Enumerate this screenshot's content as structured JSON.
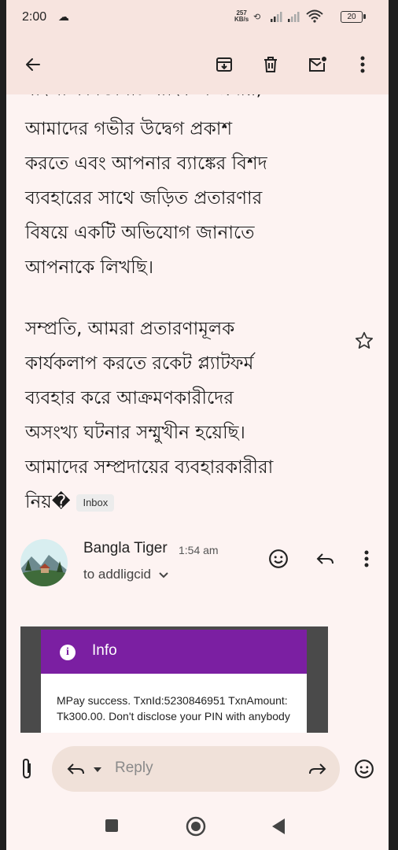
{
  "status_bar": {
    "time": "2:00",
    "net_rate_value": "257",
    "net_rate_unit": "KB/s",
    "battery": "20"
  },
  "toolbar": {
    "icons": [
      "back-arrow-icon",
      "archive-icon",
      "delete-icon",
      "mark-unread-icon",
      "more-vert-icon"
    ]
  },
  "email": {
    "clipped_line": "বাংলা কমিউনিটি ব্যাংক সম্প্রদায়,",
    "paragraph1": [
      "আমাদের গভীর উদ্বেগ প্রকাশ",
      "করতে এবং আপনার ব্যাঙ্কের বিশদ",
      "ব্যবহারের সাথে জড়িত প্রতারণার",
      "বিষয়ে একটি অভিযোগ জানাতে",
      "আপনাকে লিখছি।"
    ],
    "paragraph2": [
      "সম্প্রতি, আমরা প্রতারণামূলক",
      "কার্যকলাপ করতে রকেট প্ল্যাটফর্ম",
      "ব্যবহার করে আক্রমণকারীদের",
      "অসংখ্য ঘটনার সম্মুখীন হয়েছি।",
      "আমাদের সম্প্রদায়ের ব্যবহারকারীরা"
    ],
    "last_fragment": "নিয়�",
    "inbox_chip": "Inbox"
  },
  "message": {
    "sender": "Bangla Tiger",
    "time": "1:54 am",
    "to": "to addligcid"
  },
  "embedded_screenshot": {
    "header": "Info",
    "text": "MPay success. TxnId:5230846951 TxnAmount: Tk300.00. Don't disclose your PIN with anybody"
  },
  "reply_bar": {
    "reply_label": "Reply"
  },
  "colors": {
    "toolbar_bg": "#f7e4df",
    "page_bg": "#fdf3f2",
    "info_header": "#7b1fa2"
  }
}
